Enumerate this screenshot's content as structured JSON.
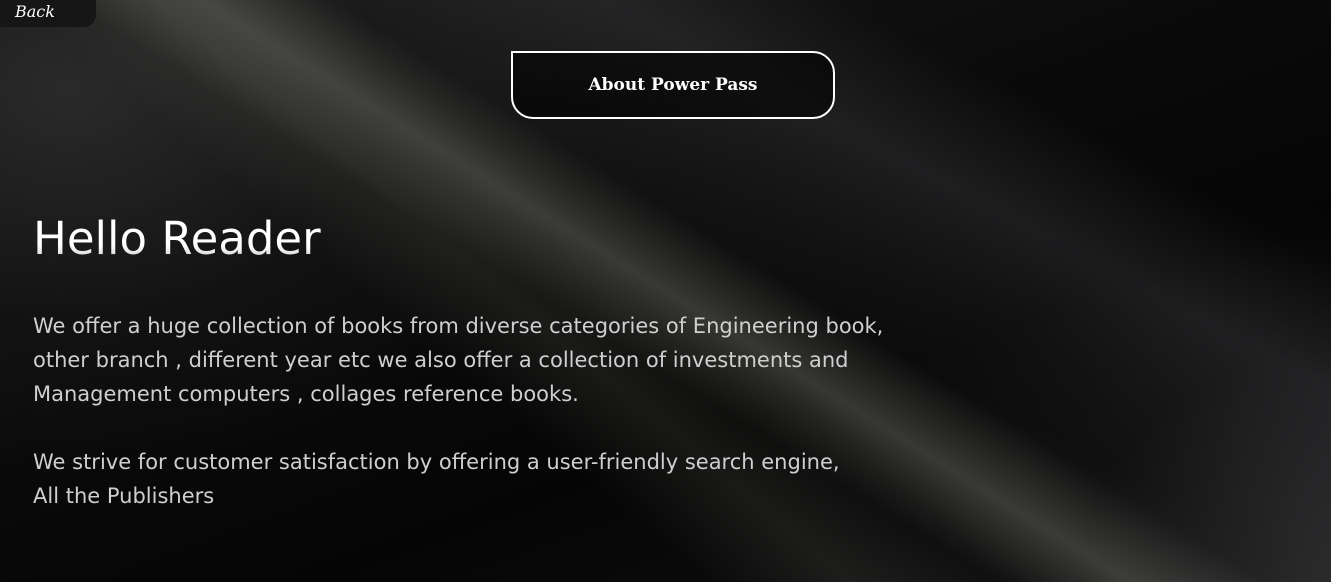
{
  "nav": {
    "back_label": "Back"
  },
  "header": {
    "about_label": "About Power Pass"
  },
  "main": {
    "title": "Hello Reader",
    "paragraph1_lines": [
      "We offer a huge collection of books from diverse categories of Engineering book,",
      "other branch , different year etc we also offer a collection of investments and",
      "Management computers , collages reference books."
    ],
    "paragraph2_lines": [
      "We strive for customer satisfaction by offering a user-friendly search engine,",
      "All the Publishers"
    ]
  },
  "colors": {
    "background": "#050505",
    "text": "#cfcfcf",
    "button_border": "#ffffff"
  }
}
